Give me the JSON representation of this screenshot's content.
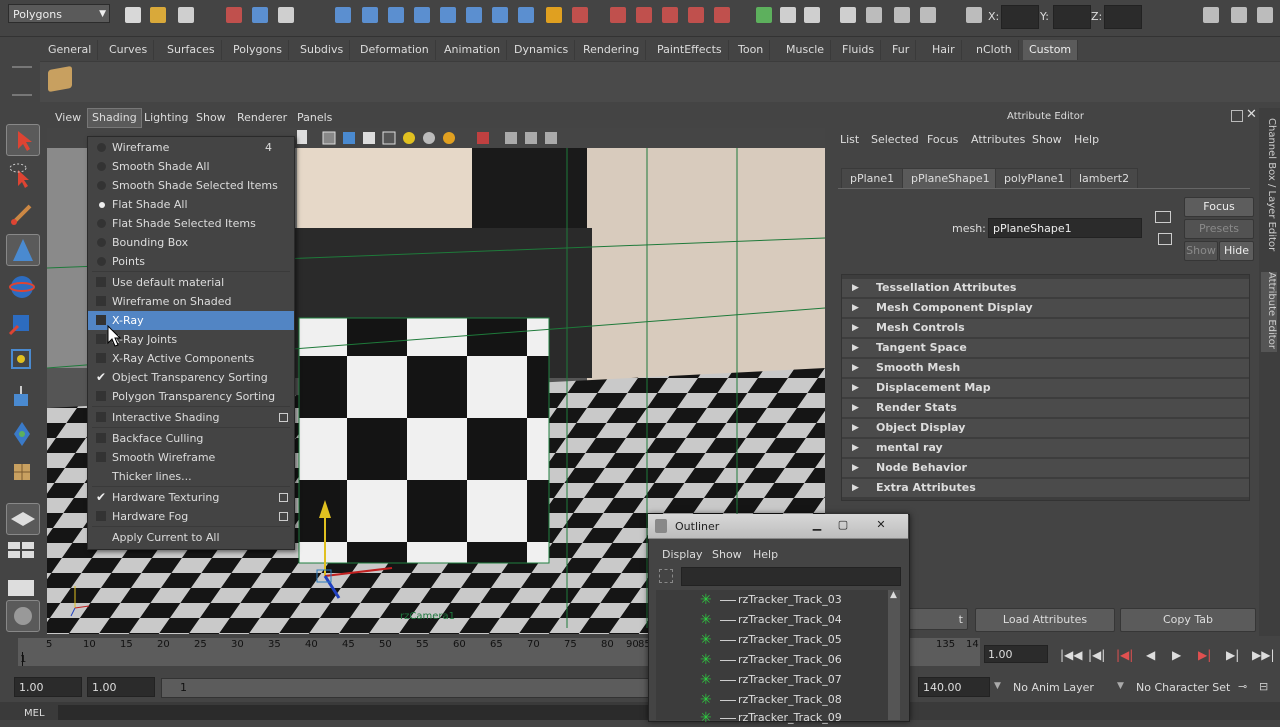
{
  "toolbar": {
    "mode": "Polygons",
    "x_label": "X:",
    "y_label": "Y:",
    "z_label": "Z:"
  },
  "shelf": {
    "tabs": [
      "General",
      "Curves",
      "Surfaces",
      "Polygons",
      "Subdivs",
      "Deformation",
      "Animation",
      "Dynamics",
      "Rendering",
      "PaintEffects",
      "Toon",
      "Muscle",
      "Fluids",
      "Fur",
      "Hair",
      "nCloth",
      "Custom"
    ],
    "active": "Custom"
  },
  "viewport": {
    "menus": [
      "View",
      "Shading",
      "Lighting",
      "Show",
      "Renderer",
      "Panels"
    ],
    "active_menu": "Shading",
    "camera_label": "rzCamera1"
  },
  "shading_menu": {
    "items": [
      {
        "label": "Wireframe",
        "shortcut": "4",
        "kind": "radio"
      },
      {
        "label": "Smooth Shade All",
        "kind": "radio"
      },
      {
        "label": "Smooth Shade Selected Items",
        "kind": "radio"
      },
      {
        "label": "Flat Shade All",
        "kind": "radio",
        "on": true
      },
      {
        "label": "Flat Shade Selected Items",
        "kind": "radio"
      },
      {
        "label": "Bounding Box",
        "kind": "radio"
      },
      {
        "label": "Points",
        "kind": "radio"
      },
      {
        "label": "Use default material",
        "kind": "check"
      },
      {
        "label": "Wireframe on Shaded",
        "kind": "check"
      },
      {
        "label": "X-Ray",
        "kind": "check",
        "highlight": true
      },
      {
        "label": "X-Ray Joints",
        "kind": "check"
      },
      {
        "label": "X-Ray Active Components",
        "kind": "check"
      },
      {
        "label": "Object Transparency Sorting",
        "kind": "check",
        "on": true
      },
      {
        "label": "Polygon Transparency Sorting",
        "kind": "check"
      },
      {
        "label": "Interactive Shading",
        "kind": "check",
        "option": true
      },
      {
        "label": "Backface Culling",
        "kind": "check"
      },
      {
        "label": "Smooth Wireframe",
        "kind": "check"
      },
      {
        "label": "Thicker lines...",
        "kind": "none"
      },
      {
        "label": "Hardware Texturing",
        "kind": "check",
        "on": true,
        "option": true
      },
      {
        "label": "Hardware Fog",
        "kind": "check",
        "option": true
      },
      {
        "label": "Apply Current to All",
        "kind": "none"
      }
    ]
  },
  "attribute_editor": {
    "title": "Attribute Editor",
    "menus": [
      "List",
      "Selected",
      "Focus",
      "Attributes",
      "Show",
      "Help"
    ],
    "tabs": [
      "pPlane1",
      "pPlaneShape1",
      "polyPlane1",
      "lambert2"
    ],
    "active_tab": "pPlaneShape1",
    "mesh_label": "mesh:",
    "mesh_value": "pPlaneShape1",
    "buttons": {
      "focus": "Focus",
      "presets": "Presets",
      "show": "Show",
      "hide": "Hide"
    },
    "sections": [
      "Tessellation Attributes",
      "Mesh Component Display",
      "Mesh Controls",
      "Tangent Space",
      "Smooth Mesh",
      "Displacement Map",
      "Render Stats",
      "Object Display",
      "mental ray",
      "Node Behavior",
      "Extra Attributes"
    ],
    "bottom_buttons": [
      "t",
      "Load Attributes",
      "Copy Tab"
    ]
  },
  "side_tabs": [
    "Channel Box / Layer Editor",
    "Attribute Editor"
  ],
  "timeline": {
    "ticks": [
      "5",
      "10",
      "15",
      "20",
      "25",
      "30",
      "35",
      "40",
      "45",
      "50",
      "55",
      "60",
      "65",
      "70",
      "75",
      "80",
      "85",
      "90",
      "135",
      "14"
    ],
    "start_frame": "1",
    "current_frame": "1.00"
  },
  "range_bar": {
    "start": "1.00",
    "playback_start": "1.00",
    "range_value": "1",
    "end": "140.00",
    "anim_layer": "No Anim Layer",
    "character_set": "No Character Set"
  },
  "command_line": {
    "label": "MEL"
  },
  "outliner": {
    "title": "Outliner",
    "menus": [
      "Display",
      "Show",
      "Help"
    ],
    "items": [
      "rzTracker_Track_03",
      "rzTracker_Track_04",
      "rzTracker_Track_05",
      "rzTracker_Track_06",
      "rzTracker_Track_07",
      "rzTracker_Track_08",
      "rzTracker_Track_09"
    ]
  }
}
